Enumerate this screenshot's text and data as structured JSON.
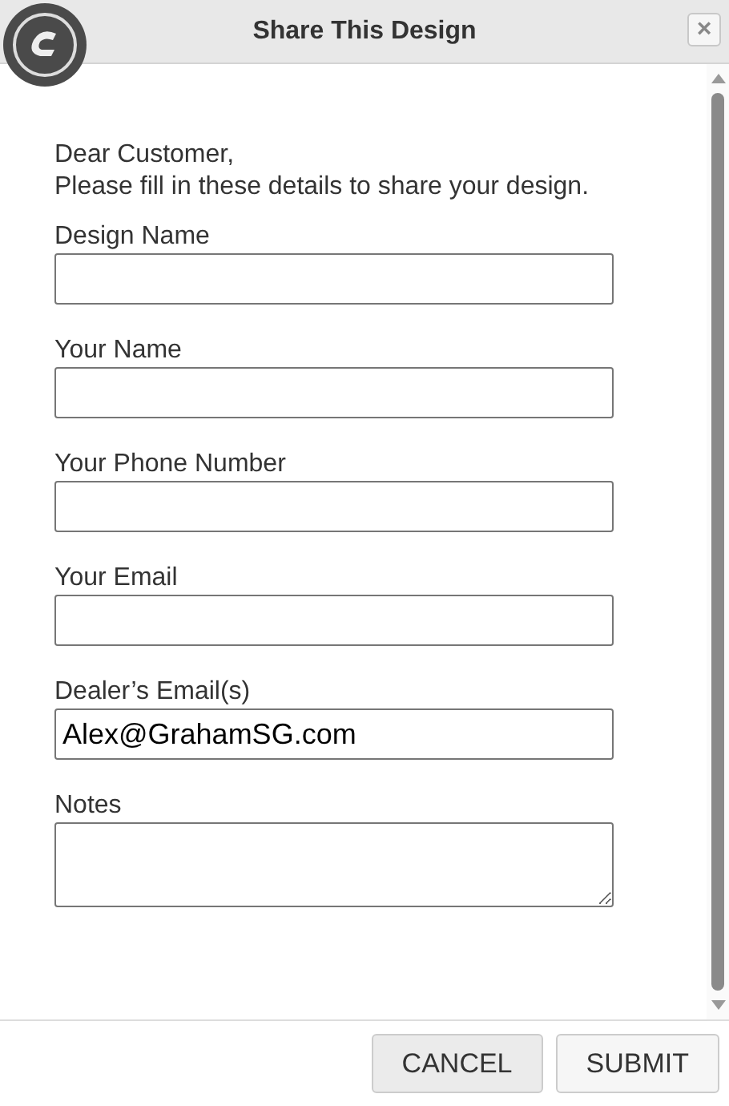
{
  "dialog": {
    "title": "Share This Design",
    "close": "×"
  },
  "intro": [
    "Dear Customer,",
    "Please fill in these details to share your design."
  ],
  "fields": [
    {
      "label": "Design Name",
      "kind": "input"
    },
    {
      "label": "Your Name",
      "kind": "input"
    },
    {
      "label": "Your Phone Number",
      "kind": "input"
    },
    {
      "label": "Your Email",
      "kind": "input"
    },
    {
      "label": "Dealer’s Email(s)",
      "kind": "input",
      "value": "Alex@GrahamSG.com"
    },
    {
      "label": "Notes",
      "kind": "textarea"
    }
  ],
  "buttons": [
    "CANCEL",
    "SUBMIT"
  ]
}
